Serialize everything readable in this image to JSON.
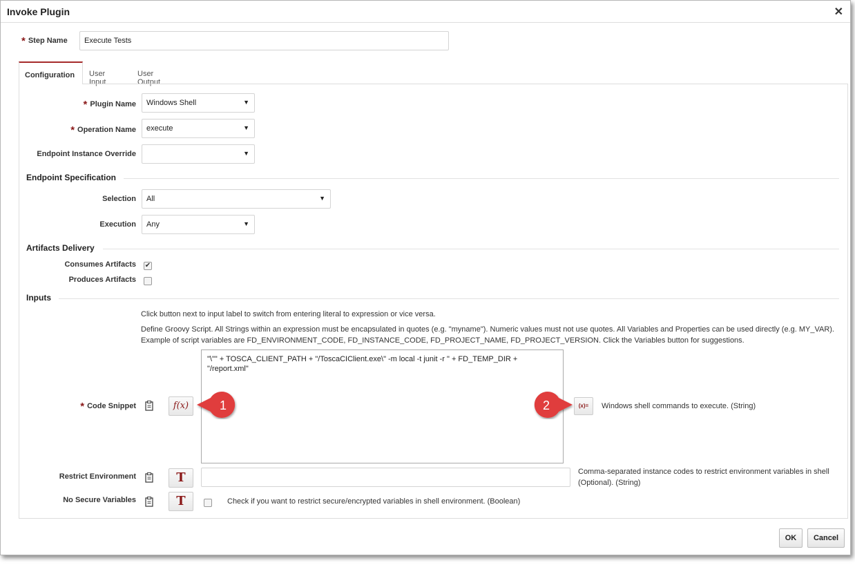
{
  "dialog": {
    "title": "Invoke Plugin",
    "close_glyph": "✕"
  },
  "step_name": {
    "label": "Step Name",
    "value": "Execute Tests"
  },
  "tabs": [
    {
      "label": "Configuration",
      "active": true
    },
    {
      "label": "User Input",
      "active": false
    },
    {
      "label": "User Output",
      "active": false
    }
  ],
  "config": {
    "plugin_name": {
      "label": "Plugin Name",
      "value": "Windows Shell"
    },
    "operation_name": {
      "label": "Operation Name",
      "value": "execute"
    },
    "endpoint_override": {
      "label": "Endpoint Instance Override",
      "value": ""
    }
  },
  "endpoint_spec": {
    "heading": "Endpoint Specification",
    "selection": {
      "label": "Selection",
      "value": "All"
    },
    "execution": {
      "label": "Execution",
      "value": "Any"
    }
  },
  "artifacts": {
    "heading": "Artifacts Delivery",
    "consumes": {
      "label": "Consumes Artifacts",
      "checked": true
    },
    "produces": {
      "label": "Produces Artifacts",
      "checked": false
    }
  },
  "inputs": {
    "heading": "Inputs",
    "hint1": "Click button next to input label to switch from entering literal to expression or vice versa.",
    "hint2": "Define Groovy Script. All Strings within an expression must be encapsulated in quotes (e.g. \"myname\"). Numeric values must not use quotes. All Variables and Properties can be used directly (e.g. MY_VAR).",
    "hint3": "Example of script variables are FD_ENVIRONMENT_CODE, FD_INSTANCE_CODE, FD_PROJECT_NAME, FD_PROJECT_VERSION. Click the Variables button for suggestions.",
    "code_snippet": {
      "label": "Code Snippet",
      "mode_button": "f(x)",
      "value": "\"\\\"\" + TOSCA_CLIENT_PATH + \"/ToscaCIClient.exe\\\" -m local -t junit -r \" + FD_TEMP_DIR +\n\"/report.xml\"",
      "variables_button": "(x)=",
      "description": "Windows shell commands to execute. (String)"
    },
    "restrict_env": {
      "label": "Restrict Environment",
      "mode_button": "T",
      "value": "",
      "description": "Comma-separated instance codes to restrict environment variables in shell (Optional). (String)"
    },
    "no_secure": {
      "label": "No Secure Variables",
      "mode_button": "T",
      "checked": false,
      "description": "Check if you want to restrict secure/encrypted variables in shell environment. (Boolean)"
    }
  },
  "callouts": {
    "one": "1",
    "two": "2"
  },
  "footer": {
    "ok_label": "OK",
    "cancel_label": "Cancel"
  },
  "colors": {
    "accent": "#a52a2a",
    "callout_red": "#e03c3c"
  }
}
